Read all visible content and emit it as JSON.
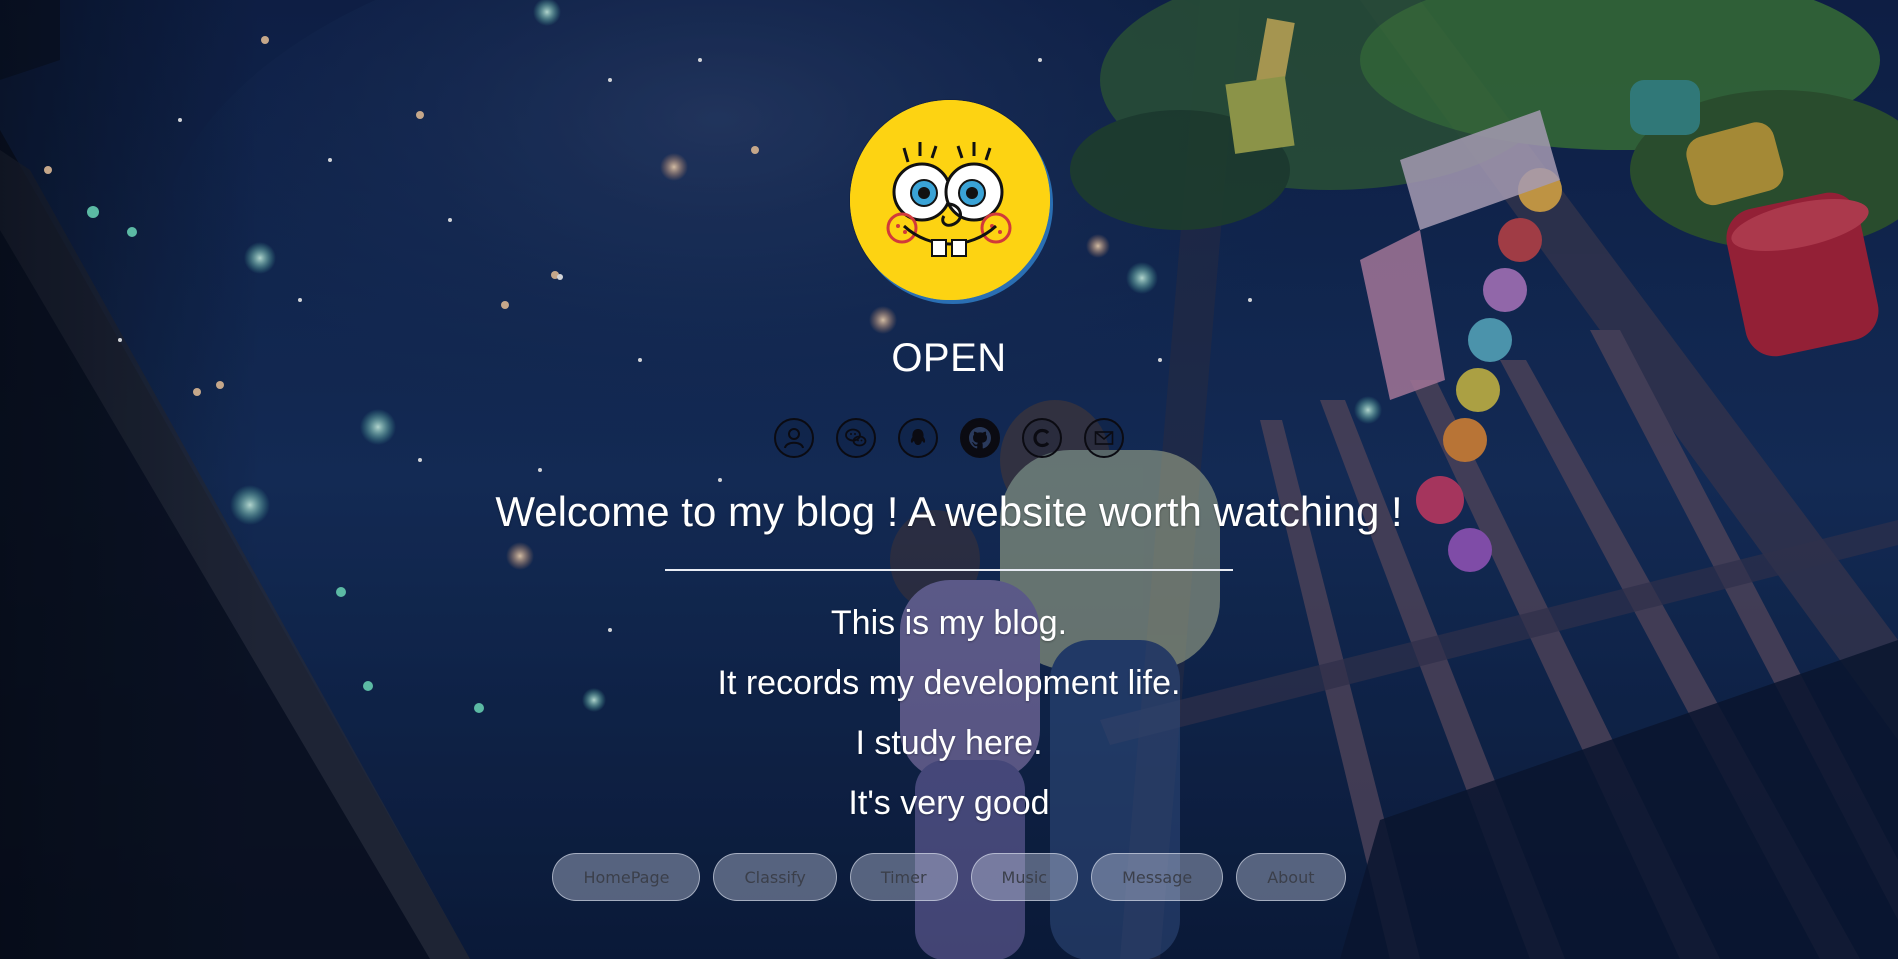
{
  "profile": {
    "name": "OPEN"
  },
  "social_icons": [
    "user-icon",
    "wechat-icon",
    "qq-icon",
    "github-icon",
    "copyright-icon",
    "mail-icon"
  ],
  "headline": "Welcome to my blog ! A website worth watching !",
  "intro_lines": [
    "This is my blog.",
    "It records my development life.",
    "I study here.",
    "It's very good"
  ],
  "nav": {
    "items": [
      "HomePage",
      "Classify",
      "Timer",
      "Music",
      "Message",
      "About"
    ]
  },
  "colors": {
    "sky": "#0d1e45",
    "text": "#ffffff",
    "avatar_bg": "#fdd312",
    "icon_stroke": "#0b0b12",
    "button_text": "#3b3f4a"
  }
}
